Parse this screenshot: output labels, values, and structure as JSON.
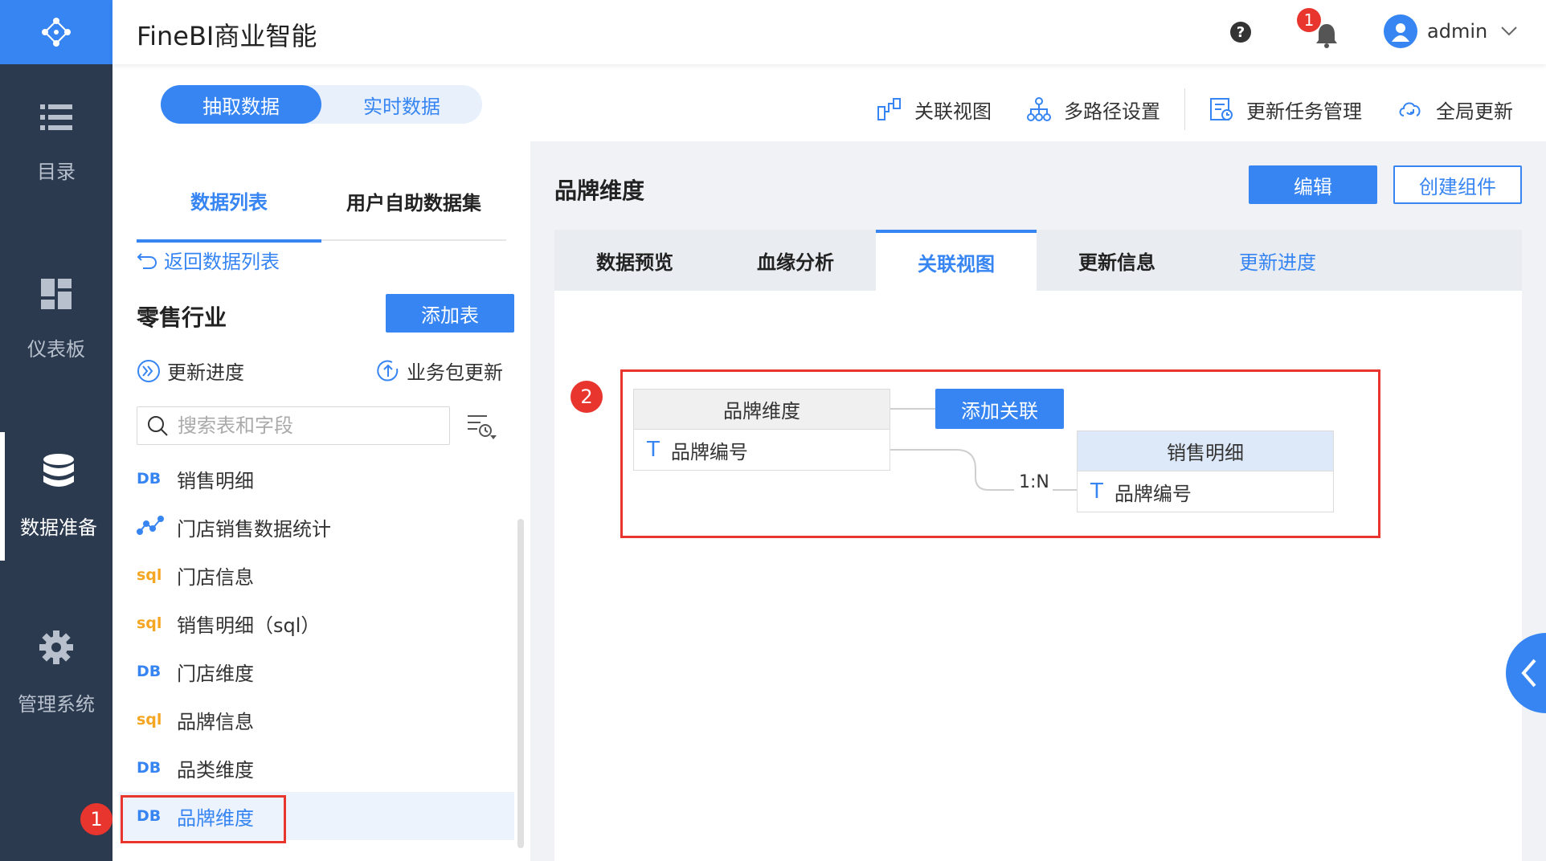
{
  "app": {
    "title": "FineBI商业智能"
  },
  "nav": {
    "items": [
      {
        "label": "目录",
        "icon": "list-icon"
      },
      {
        "label": "仪表板",
        "icon": "dashboard-icon"
      },
      {
        "label": "数据准备",
        "icon": "database-icon",
        "active": true
      },
      {
        "label": "管理系统",
        "icon": "gear-icon"
      }
    ]
  },
  "topbar": {
    "notification_count": "1",
    "user": "admin"
  },
  "mode": {
    "extract": "抽取数据",
    "realtime": "实时数据",
    "selected": "抽取数据"
  },
  "toolbar": {
    "relation_view": "关联视图",
    "multipath": "多路径设置",
    "task_manage": "更新任务管理",
    "global_update": "全局更新"
  },
  "left": {
    "tabs": [
      "数据列表",
      "用户自助数据集"
    ],
    "back": "返回数据列表",
    "package": "零售行业",
    "add_table": "添加表",
    "update_progress": "更新进度",
    "biz_update": "业务包更新",
    "search_placeholder": "搜索表和字段",
    "tables": [
      {
        "type": "DB",
        "name": "销售明细"
      },
      {
        "type": "self",
        "name": "门店销售数据统计"
      },
      {
        "type": "sql",
        "name": "门店信息"
      },
      {
        "type": "sql",
        "name": "销售明细（sql）"
      },
      {
        "type": "DB",
        "name": "门店维度"
      },
      {
        "type": "sql",
        "name": "品牌信息"
      },
      {
        "type": "DB",
        "name": "品类维度"
      },
      {
        "type": "DB",
        "name": "品牌维度",
        "selected": true
      }
    ]
  },
  "right": {
    "title": "品牌维度",
    "edit": "编辑",
    "create_component": "创建组件",
    "tabs": [
      "数据预览",
      "血缘分析",
      "关联视图",
      "更新信息",
      "更新进度"
    ],
    "active_tab": "关联视图",
    "diagram": {
      "source_table": "品牌维度",
      "source_field": "品牌编号",
      "target_table": "销售明细",
      "target_field": "品牌编号",
      "relation": "1:N",
      "add_relation": "添加关联"
    }
  },
  "annotations": {
    "marker1": "1",
    "marker2": "2"
  },
  "colors": {
    "primary": "#3685f2",
    "nav_bg": "#2b3a4f",
    "highlight": "#e8352e",
    "sql": "#f5a623"
  }
}
